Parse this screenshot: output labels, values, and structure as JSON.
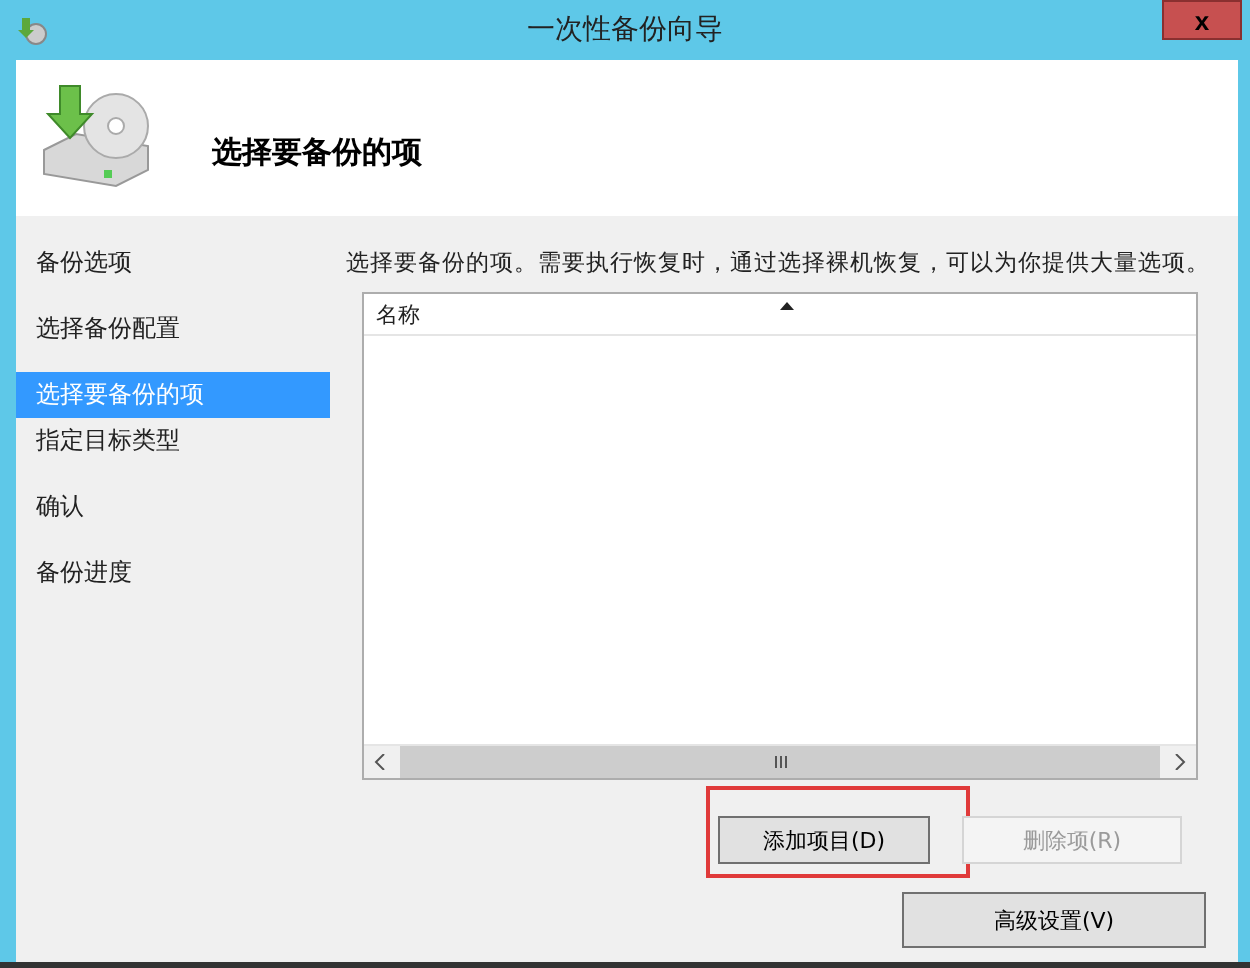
{
  "window": {
    "title": "一次性备份向导",
    "close": "x"
  },
  "header": {
    "title": "选择要备份的项"
  },
  "steps": [
    {
      "label": "备份选项",
      "selected": false
    },
    {
      "label": "选择备份配置",
      "selected": false
    },
    {
      "label": "选择要备份的项",
      "selected": true
    },
    {
      "label": "指定目标类型",
      "selected": false
    },
    {
      "label": "确认",
      "selected": false
    },
    {
      "label": "备份进度",
      "selected": false
    }
  ],
  "description": "选择要备份的项。需要执行恢复时，通过选择裸机恢复，可以为你提供大量选项。",
  "list": {
    "columns": [
      "名称"
    ]
  },
  "buttons": [
    {
      "label": "添加项目(D)",
      "disabled": false,
      "highlighted": true
    },
    {
      "label": "删除项(R)",
      "disabled": true,
      "highlighted": false
    }
  ],
  "advanced_button": "高级设置(V)"
}
